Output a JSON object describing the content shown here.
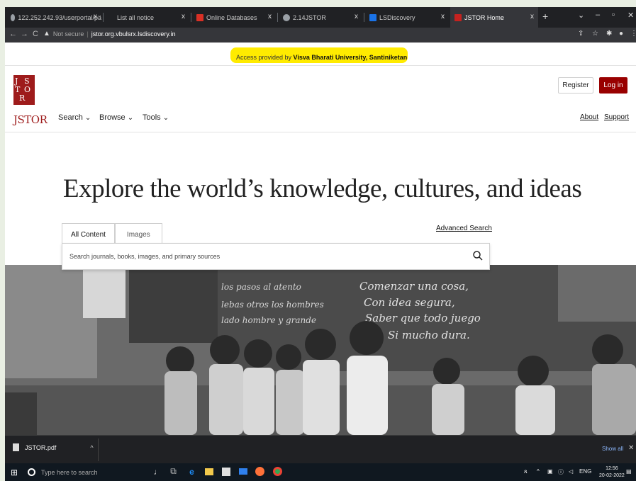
{
  "browser": {
    "tabs": [
      {
        "label": "122.252.242.93/userportal/pä",
        "favicon": "globe-icon"
      },
      {
        "label": "List all notice",
        "favicon": "blank-page-icon"
      },
      {
        "label": "Online Databases",
        "favicon": "red-db-icon"
      },
      {
        "label": "2.14JSTOR",
        "favicon": "globe-icon"
      },
      {
        "label": "LSDiscovery",
        "favicon": "blue-ls-icon"
      },
      {
        "label": "JSTOR Home",
        "favicon": "jstor-icon"
      }
    ],
    "tab_close": "x",
    "new_tab": "+",
    "not_secure": "Not secure",
    "url": "jstor.org.vbulsrx.lsdiscovery.in"
  },
  "banner": {
    "prefix": "Access provided by ",
    "institution": "Visva Bharati University, Santiniketan",
    "highlight_color": "#ffeb00"
  },
  "header": {
    "logo_text": "JSTOR",
    "menu": [
      {
        "label": "Search"
      },
      {
        "label": "Browse"
      },
      {
        "label": "Tools"
      }
    ],
    "register": "Register",
    "login": "Log in",
    "about": "About",
    "support": "Support",
    "brand_color": "#990000"
  },
  "hero": {
    "title": "Explore the world’s knowledge, cultures, and ideas",
    "tabs": [
      {
        "label": "All Content",
        "active": true
      },
      {
        "label": "Images",
        "active": false
      }
    ],
    "advanced_search": "Advanced Search",
    "search_placeholder": "Search journals, books, images, and primary sources"
  },
  "photo": {
    "chalk_lines": [
      "Comenzar una cosa,",
      "Con idea segura,",
      "Saber que todo juego",
      "Si mucho dura."
    ]
  },
  "downloads": {
    "file": "JSTOR.pdf",
    "show_all": "Show all"
  },
  "taskbar": {
    "search_placeholder": "Type here to search",
    "lang": "ENG",
    "time": "12:56",
    "date": "20-02-2022"
  }
}
